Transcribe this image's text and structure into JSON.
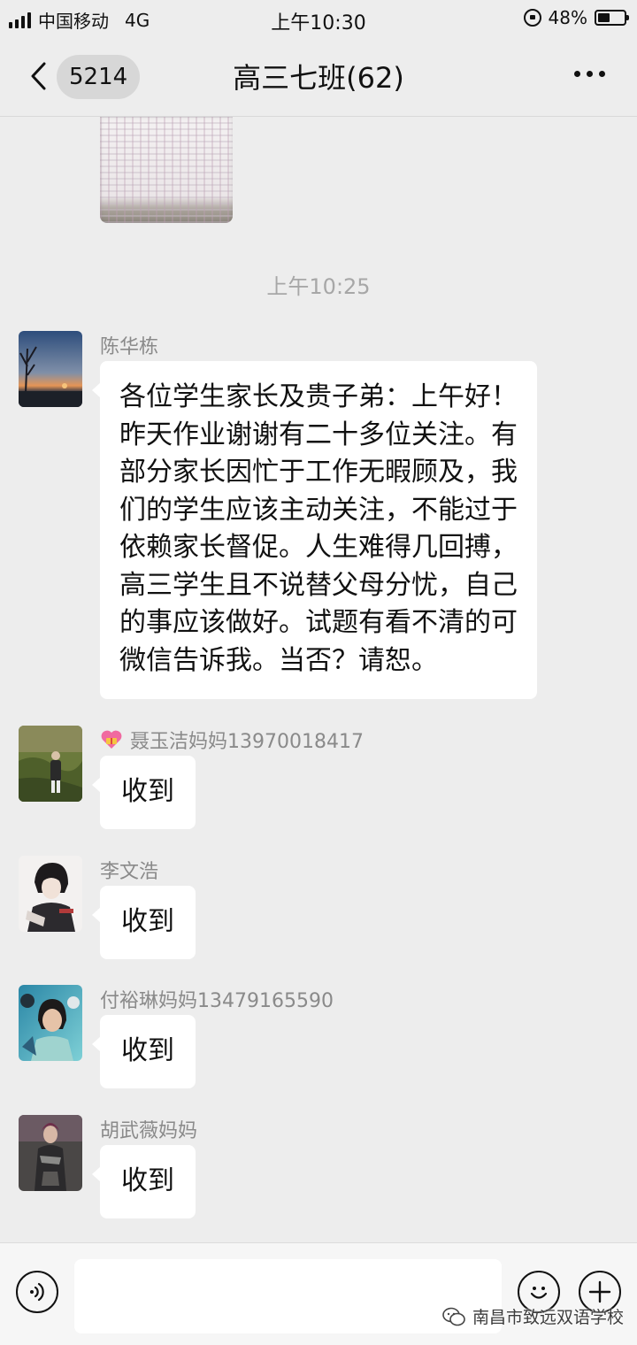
{
  "status_bar": {
    "carrier": "中国移动",
    "network": "4G",
    "time": "上午10:30",
    "battery_percent": "48%",
    "battery_level": 0.48
  },
  "header": {
    "unread_count": "5214",
    "title": "高三七班(62)",
    "back_icon": "chevron-left-icon",
    "more_icon": "more-dots-icon"
  },
  "chat": {
    "timestamp": "上午10:25",
    "messages": [
      {
        "sender": "陈华栋",
        "text": "各位学生家长及贵子弟：上午好！昨天作业谢谢有二十多位关注。有部分家长因忙于工作无暇顾及，我们的学生应该主动关注，不能过于依赖家长督促。人生难得几回搏，高三学生且不说替父母分忧，自己的事应该做好。试题有看不清的可微信告诉我。当否？请恕。",
        "lines": [
          "各位学生家长及贵子弟：上午好！",
          "昨天作业谢谢有二十多位关注。有",
          "部分家长因忙于工作无暇顾及，我",
          "们的学生应该主动关注，不能过于",
          "依赖家长督促。人生难得几回搏，",
          "高三学生且不说替父母分忧，自己",
          "的事应该做好。试题有看不清的可",
          "微信告诉我。当否？请恕。"
        ]
      },
      {
        "sender": "聂玉洁妈妈13970018417",
        "text": "收到"
      },
      {
        "sender": "李文浩",
        "text": "收到"
      },
      {
        "sender": "付裕琳妈妈13479165590",
        "text": "收到"
      },
      {
        "sender": "胡武薇妈妈",
        "text": "收到"
      }
    ]
  },
  "input_bar": {
    "voice_icon": "voice-icon",
    "emoji_icon": "emoji-icon",
    "plus_icon": "plus-icon",
    "input_value": ""
  },
  "watermark": {
    "text": "南昌市致远双语学校"
  },
  "colors": {
    "background": "#ededed",
    "bubble": "#ffffff",
    "sender_name": "#8a8a8a",
    "timestamp": "#a7a7a7"
  }
}
